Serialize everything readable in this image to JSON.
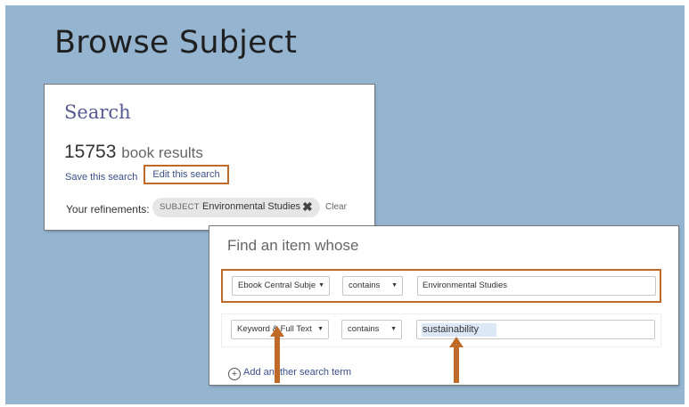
{
  "slide": {
    "title": "Browse Subject"
  },
  "panel_search": {
    "heading": "Search",
    "result_count": "15753",
    "result_label": "book results",
    "save_link": "Save this search",
    "edit_link": "Edit this search",
    "refinements_label": "Your refinements:",
    "chip": {
      "tag": "SUBJECT",
      "value": "Environmental Studies",
      "remove_icon": "close-icon"
    },
    "clear_link": "Clear"
  },
  "panel_find": {
    "heading": "Find an item whose",
    "rows": [
      {
        "field": "Ebook Central Subje",
        "operator": "contains",
        "value": "Environmental Studies"
      },
      {
        "field": "Keyword & Full Text",
        "operator": "contains",
        "value": "sustainability"
      }
    ],
    "add_term": "Add another search term"
  },
  "colors": {
    "slide_bg": "#94b4d0",
    "highlight_box": "#c06a2a",
    "arrow": "#c06a2a",
    "link": "#3a4f8a"
  }
}
